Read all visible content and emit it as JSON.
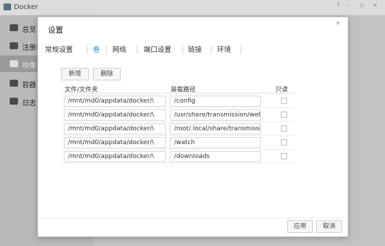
{
  "app": {
    "title": "Docker"
  },
  "window_controls": [
    "?",
    "–",
    "▫",
    "×"
  ],
  "sidebar": {
    "items": [
      {
        "label": "总览",
        "icon": "monitor-icon"
      },
      {
        "label": "注册表",
        "icon": "registry-icon"
      },
      {
        "label": "映像",
        "icon": "image-icon"
      },
      {
        "label": "容器",
        "icon": "container-icon"
      },
      {
        "label": "日志",
        "icon": "log-icon"
      }
    ],
    "active_index": 2
  },
  "dialog": {
    "title": "设置",
    "close": "×",
    "tabs": [
      "常规设置",
      "卷",
      "网络",
      "端口设置",
      "链接",
      "环境"
    ],
    "active_tab": "卷",
    "add_button": "新增",
    "delete_button": "删除",
    "columns": {
      "folder": "文件/文件夹",
      "mount": "装载路径",
      "readonly": "只读"
    },
    "rows": [
      {
        "folder": "/mnt/md0/appdata/docker/\\",
        "mount": "/config",
        "readonly": false
      },
      {
        "folder": "/mnt/md0/appdata/docker/\\",
        "mount": "/usr/share/transmission/web",
        "readonly": false
      },
      {
        "folder": "/mnt/md0/appdata/docker/\\",
        "mount": "/root/.local/share/transmissi",
        "readonly": false
      },
      {
        "folder": "/mnt/md0/appdata/docker/\\",
        "mount": "/watch",
        "readonly": false
      },
      {
        "folder": "/mnt/md0/appdata/docker/\\",
        "mount": "/downloads",
        "readonly": false
      }
    ],
    "apply_button": "应用",
    "cancel_button": "取消"
  },
  "colors": {
    "accent": "#1e88e5",
    "sidebar": "#b9b9b9",
    "sidebar_active": "#9a9a9a"
  }
}
